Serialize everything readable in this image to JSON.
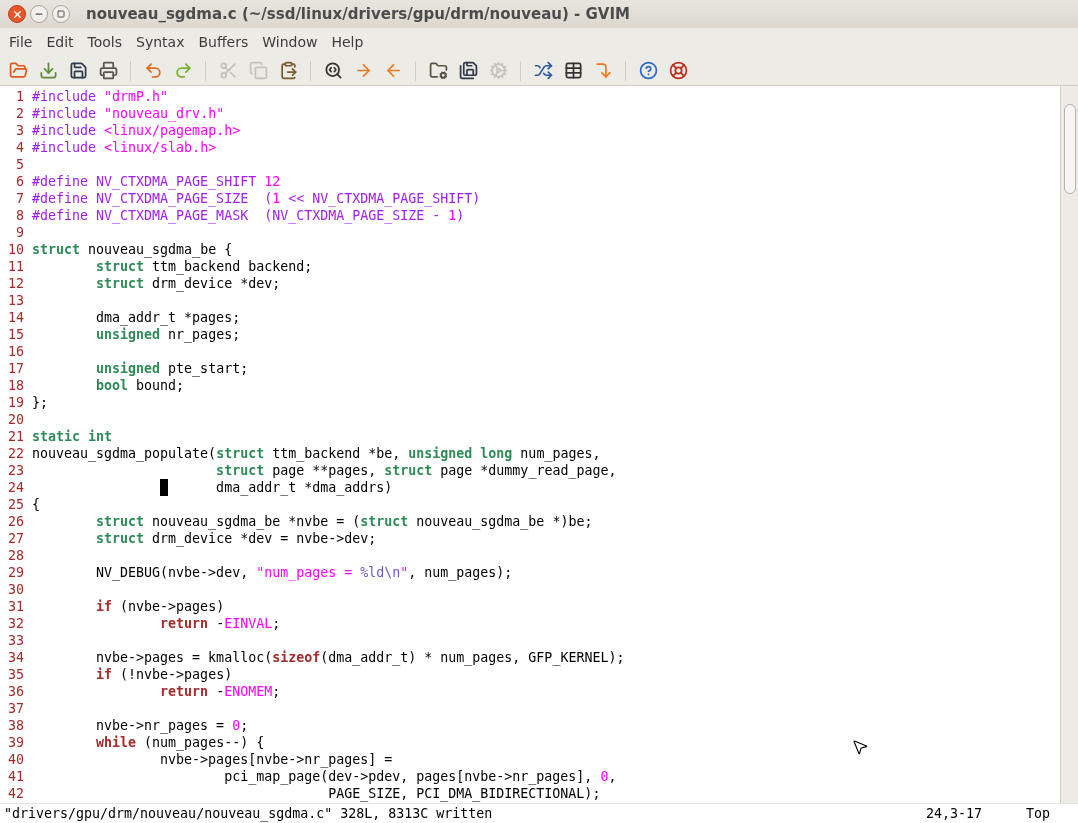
{
  "window": {
    "title": "nouveau_sgdma.c (~/ssd/linux/drivers/gpu/drm/nouveau) - GVIM"
  },
  "menu": [
    "File",
    "Edit",
    "Tools",
    "Syntax",
    "Buffers",
    "Window",
    "Help"
  ],
  "toolbar": [
    {
      "kind": "open",
      "disabled": false
    },
    {
      "kind": "download",
      "disabled": false
    },
    {
      "kind": "save",
      "disabled": false
    },
    {
      "kind": "print",
      "disabled": false
    },
    {
      "kind": "separator"
    },
    {
      "kind": "undo",
      "disabled": false
    },
    {
      "kind": "redo",
      "disabled": false
    },
    {
      "kind": "separator"
    },
    {
      "kind": "cut",
      "disabled": true
    },
    {
      "kind": "copy",
      "disabled": true
    },
    {
      "kind": "paste",
      "disabled": false
    },
    {
      "kind": "separator"
    },
    {
      "kind": "find",
      "disabled": false
    },
    {
      "kind": "forward",
      "disabled": false
    },
    {
      "kind": "back",
      "disabled": false
    },
    {
      "kind": "separator"
    },
    {
      "kind": "folder-gear",
      "disabled": false
    },
    {
      "kind": "save-gear",
      "disabled": false
    },
    {
      "kind": "gears",
      "disabled": true
    },
    {
      "kind": "separator"
    },
    {
      "kind": "make",
      "disabled": false
    },
    {
      "kind": "table",
      "disabled": false
    },
    {
      "kind": "jump",
      "disabled": false
    },
    {
      "kind": "separator"
    },
    {
      "kind": "help",
      "disabled": false
    },
    {
      "kind": "lifebuoy",
      "disabled": false
    }
  ],
  "editor": {
    "lines": [
      {
        "number": "1",
        "tokens": [
          {
            "text": "#include ",
            "kind": "preproc"
          },
          {
            "text": "\"drmP.h\"",
            "kind": "string"
          }
        ]
      },
      {
        "number": "2",
        "tokens": [
          {
            "text": "#include ",
            "kind": "preproc"
          },
          {
            "text": "\"nouveau_drv.h\"",
            "kind": "string"
          }
        ]
      },
      {
        "number": "3",
        "tokens": [
          {
            "text": "#include ",
            "kind": "preproc"
          },
          {
            "text": "<linux/pagemap.h>",
            "kind": "string"
          }
        ]
      },
      {
        "number": "4",
        "tokens": [
          {
            "text": "#include ",
            "kind": "preproc"
          },
          {
            "text": "<linux/slab.h>",
            "kind": "string"
          }
        ]
      },
      {
        "number": "5"
      },
      {
        "number": "6",
        "tokens": [
          {
            "text": "#define NV_CTXDMA_PAGE_SHIFT ",
            "kind": "preproc"
          },
          {
            "text": "12",
            "kind": "string"
          }
        ]
      },
      {
        "number": "7",
        "tokens": [
          {
            "text": "#define NV_CTXDMA_PAGE_SIZE  (",
            "kind": "preproc"
          },
          {
            "text": "1",
            "kind": "string"
          },
          {
            "text": " << NV_CTXDMA_PAGE_SHIFT)",
            "kind": "preproc"
          }
        ]
      },
      {
        "number": "8",
        "tokens": [
          {
            "text": "#define NV_CTXDMA_PAGE_MASK  (NV_CTXDMA_PAGE_SIZE - ",
            "kind": "preproc"
          },
          {
            "text": "1",
            "kind": "string"
          },
          {
            "text": ")",
            "kind": "preproc"
          }
        ]
      },
      {
        "number": "9"
      },
      {
        "number": "10",
        "tokens": [
          {
            "text": "struct",
            "kind": "type"
          },
          {
            "text": " nouveau_sgdma_be {",
            "kind": "plain"
          }
        ]
      },
      {
        "number": "11",
        "tokens": [
          {
            "text": "        struct",
            "kind": "type"
          },
          {
            "text": " ttm_backend backend;",
            "kind": "plain"
          }
        ]
      },
      {
        "number": "12",
        "tokens": [
          {
            "text": "        struct",
            "kind": "type"
          },
          {
            "text": " drm_device *dev;",
            "kind": "plain"
          }
        ]
      },
      {
        "number": "13"
      },
      {
        "number": "14",
        "tokens": [
          {
            "text": "        dma_addr_t *pages;",
            "kind": "plain"
          }
        ]
      },
      {
        "number": "15",
        "tokens": [
          {
            "text": "        unsigned",
            "kind": "type"
          },
          {
            "text": " nr_pages;",
            "kind": "plain"
          }
        ]
      },
      {
        "number": "16"
      },
      {
        "number": "17",
        "tokens": [
          {
            "text": "        unsigned",
            "kind": "type"
          },
          {
            "text": " pte_start;",
            "kind": "plain"
          }
        ]
      },
      {
        "number": "18",
        "tokens": [
          {
            "text": "        bool",
            "kind": "type"
          },
          {
            "text": " bound;",
            "kind": "plain"
          }
        ]
      },
      {
        "number": "19",
        "tokens": [
          {
            "text": "};",
            "kind": "plain"
          }
        ]
      },
      {
        "number": "20"
      },
      {
        "number": "21",
        "tokens": [
          {
            "text": "static int",
            "kind": "type"
          }
        ]
      },
      {
        "number": "22",
        "tokens": [
          {
            "text": "nouveau_sgdma_populate(",
            "kind": "plain"
          },
          {
            "text": "struct",
            "kind": "type"
          },
          {
            "text": " ttm_backend *be, ",
            "kind": "plain"
          },
          {
            "text": "unsigned long",
            "kind": "type"
          },
          {
            "text": " num_pages,",
            "kind": "plain"
          }
        ]
      },
      {
        "number": "23",
        "tokens": [
          {
            "text": "                       struct",
            "kind": "type"
          },
          {
            "text": " page **pages, ",
            "kind": "plain"
          },
          {
            "text": "struct",
            "kind": "type"
          },
          {
            "text": " page *dummy_read_page,",
            "kind": "plain"
          }
        ]
      },
      {
        "number": "24",
        "cursor": true,
        "tokens": [
          {
            "text": "                       dma_addr_t *dma_addrs)",
            "kind": "plain"
          }
        ]
      },
      {
        "number": "25",
        "tokens": [
          {
            "text": "{",
            "kind": "plain"
          }
        ]
      },
      {
        "number": "26",
        "tokens": [
          {
            "text": "        struct",
            "kind": "type"
          },
          {
            "text": " nouveau_sgdma_be *nvbe = (",
            "kind": "plain"
          },
          {
            "text": "struct",
            "kind": "type"
          },
          {
            "text": " nouveau_sgdma_be *)be;",
            "kind": "plain"
          }
        ]
      },
      {
        "number": "27",
        "tokens": [
          {
            "text": "        struct",
            "kind": "type"
          },
          {
            "text": " drm_device *dev = nvbe->dev;",
            "kind": "plain"
          }
        ]
      },
      {
        "number": "28"
      },
      {
        "number": "29",
        "tokens": [
          {
            "text": "        NV_DEBUG(nvbe->dev, ",
            "kind": "plain"
          },
          {
            "text": "\"num_pages = ",
            "kind": "string"
          },
          {
            "text": "%ld\\n",
            "kind": "special"
          },
          {
            "text": "\"",
            "kind": "string"
          },
          {
            "text": ", num_pages);",
            "kind": "plain"
          }
        ]
      },
      {
        "number": "30"
      },
      {
        "number": "31",
        "tokens": [
          {
            "text": "        if",
            "kind": "statement"
          },
          {
            "text": " (nvbe->pages)",
            "kind": "plain"
          }
        ]
      },
      {
        "number": "32",
        "tokens": [
          {
            "text": "                return",
            "kind": "statement"
          },
          {
            "text": " -",
            "kind": "plain"
          },
          {
            "text": "EINVAL",
            "kind": "string"
          },
          {
            "text": ";",
            "kind": "plain"
          }
        ]
      },
      {
        "number": "33"
      },
      {
        "number": "34",
        "tokens": [
          {
            "text": "        nvbe->pages = kmalloc(",
            "kind": "plain"
          },
          {
            "text": "sizeof",
            "kind": "statement"
          },
          {
            "text": "(dma_addr_t) * num_pages, GFP_KERNEL);",
            "kind": "plain"
          }
        ]
      },
      {
        "number": "35",
        "tokens": [
          {
            "text": "        if",
            "kind": "statement"
          },
          {
            "text": " (!nvbe->pages)",
            "kind": "plain"
          }
        ]
      },
      {
        "number": "36",
        "tokens": [
          {
            "text": "                return",
            "kind": "statement"
          },
          {
            "text": " -",
            "kind": "plain"
          },
          {
            "text": "ENOMEM",
            "kind": "string"
          },
          {
            "text": ";",
            "kind": "plain"
          }
        ]
      },
      {
        "number": "37"
      },
      {
        "number": "38",
        "tokens": [
          {
            "text": "        nvbe->nr_pages = ",
            "kind": "plain"
          },
          {
            "text": "0",
            "kind": "string"
          },
          {
            "text": ";",
            "kind": "plain"
          }
        ]
      },
      {
        "number": "39",
        "tokens": [
          {
            "text": "        while",
            "kind": "statement"
          },
          {
            "text": " (num_pages--) {",
            "kind": "plain"
          }
        ]
      },
      {
        "number": "40",
        "tokens": [
          {
            "text": "                nvbe->pages[nvbe->nr_pages] =",
            "kind": "plain"
          }
        ]
      },
      {
        "number": "41",
        "tokens": [
          {
            "text": "                        pci_map_page(dev->pdev, pages[nvbe->nr_pages], ",
            "kind": "plain"
          },
          {
            "text": "0",
            "kind": "string"
          },
          {
            "text": ",",
            "kind": "plain"
          }
        ]
      },
      {
        "number": "42",
        "tokens": [
          {
            "text": "                                     PAGE_SIZE, PCI_DMA_BIDIRECTIONAL);",
            "kind": "plain"
          }
        ]
      }
    ]
  },
  "status_line": {
    "message": "\"drivers/gpu/drm/nouveau/nouveau_sgdma.c\" 328L, 8313C written",
    "position": "24,3-17",
    "scroll": "Top"
  }
}
